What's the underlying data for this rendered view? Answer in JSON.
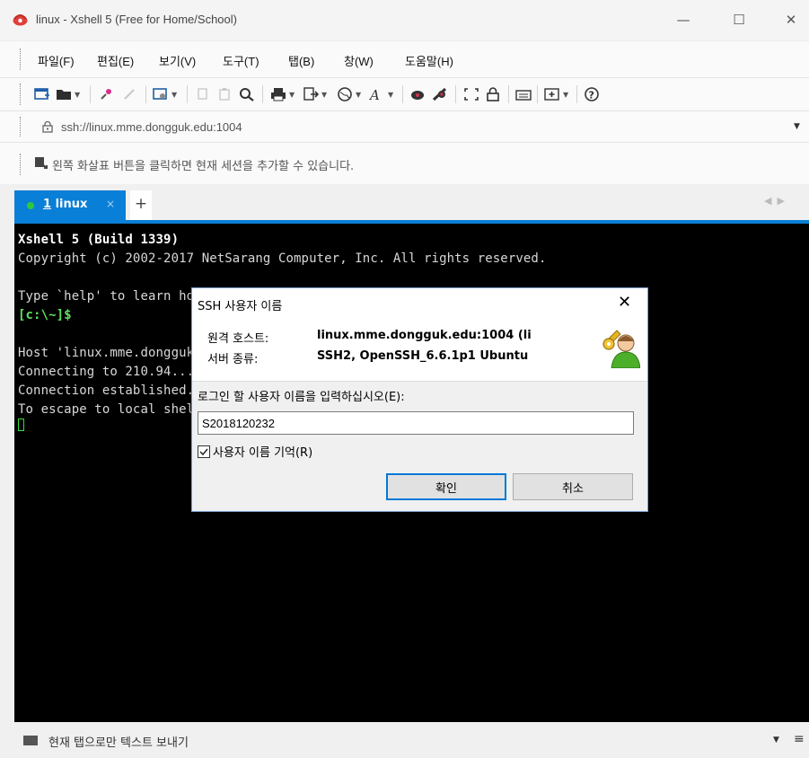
{
  "window": {
    "title": "linux - Xshell 5 (Free for Home/School)",
    "minimize": "—",
    "maximize": "☐",
    "close": "✕"
  },
  "menu": [
    "파일(F)",
    "편집(E)",
    "보기(V)",
    "도구(T)",
    "탭(B)",
    "창(W)",
    "도움말(H)"
  ],
  "address": {
    "url": "ssh://linux.mme.dongguk.edu:1004",
    "dropdown": "▼"
  },
  "hint": {
    "text": "왼쪽 화살표 버튼을 클릭하면 현재 세션을 추가할 수 있습니다."
  },
  "tabs": {
    "active_number": "1",
    "active_name": " linux",
    "close": "×",
    "add": "+",
    "scroll": "◀▶"
  },
  "terminal": {
    "lines": [
      "Xshell 5 (Build 1339)",
      "Copyright (c) 2002-2017 NetSarang Computer, Inc. All rights reserved.",
      "",
      "Type `help' to learn how to use Xshell prompt.",
      "[c:\\~]$",
      "",
      "Host 'linux.mme.dongguk.edu' resolved to 210.94...",
      "Connecting to 210.94...",
      "Connection established.",
      "To escape to local shell, press 'Ctrl+Alt+]'."
    ]
  },
  "dialog": {
    "title": "SSH 사용자 이름",
    "close": "✕",
    "remote_host_label": "원격 호스트:",
    "remote_host_value": "linux.mme.dongguk.edu:1004 (li",
    "server_type_label": "서버 종류:",
    "server_type_value": "SSH2, OpenSSH_6.6.1p1 Ubuntu",
    "prompt": "로그인 할 사용자 이름을 입력하십시오(E):",
    "username": "S2018120232",
    "remember_label": "사용자 이름 기억(R)",
    "remember_checked": true,
    "ok": "확인",
    "cancel": "취소"
  },
  "status": {
    "text": "현재 탭으로만 텍스트 보내기",
    "dropdown": "▼",
    "menu": "≡"
  },
  "colors": {
    "accent": "#0a7fd7",
    "terminal_bg": "#000000",
    "prompt_green": "#5fe05f",
    "connected_dot": "#2ec93b"
  }
}
